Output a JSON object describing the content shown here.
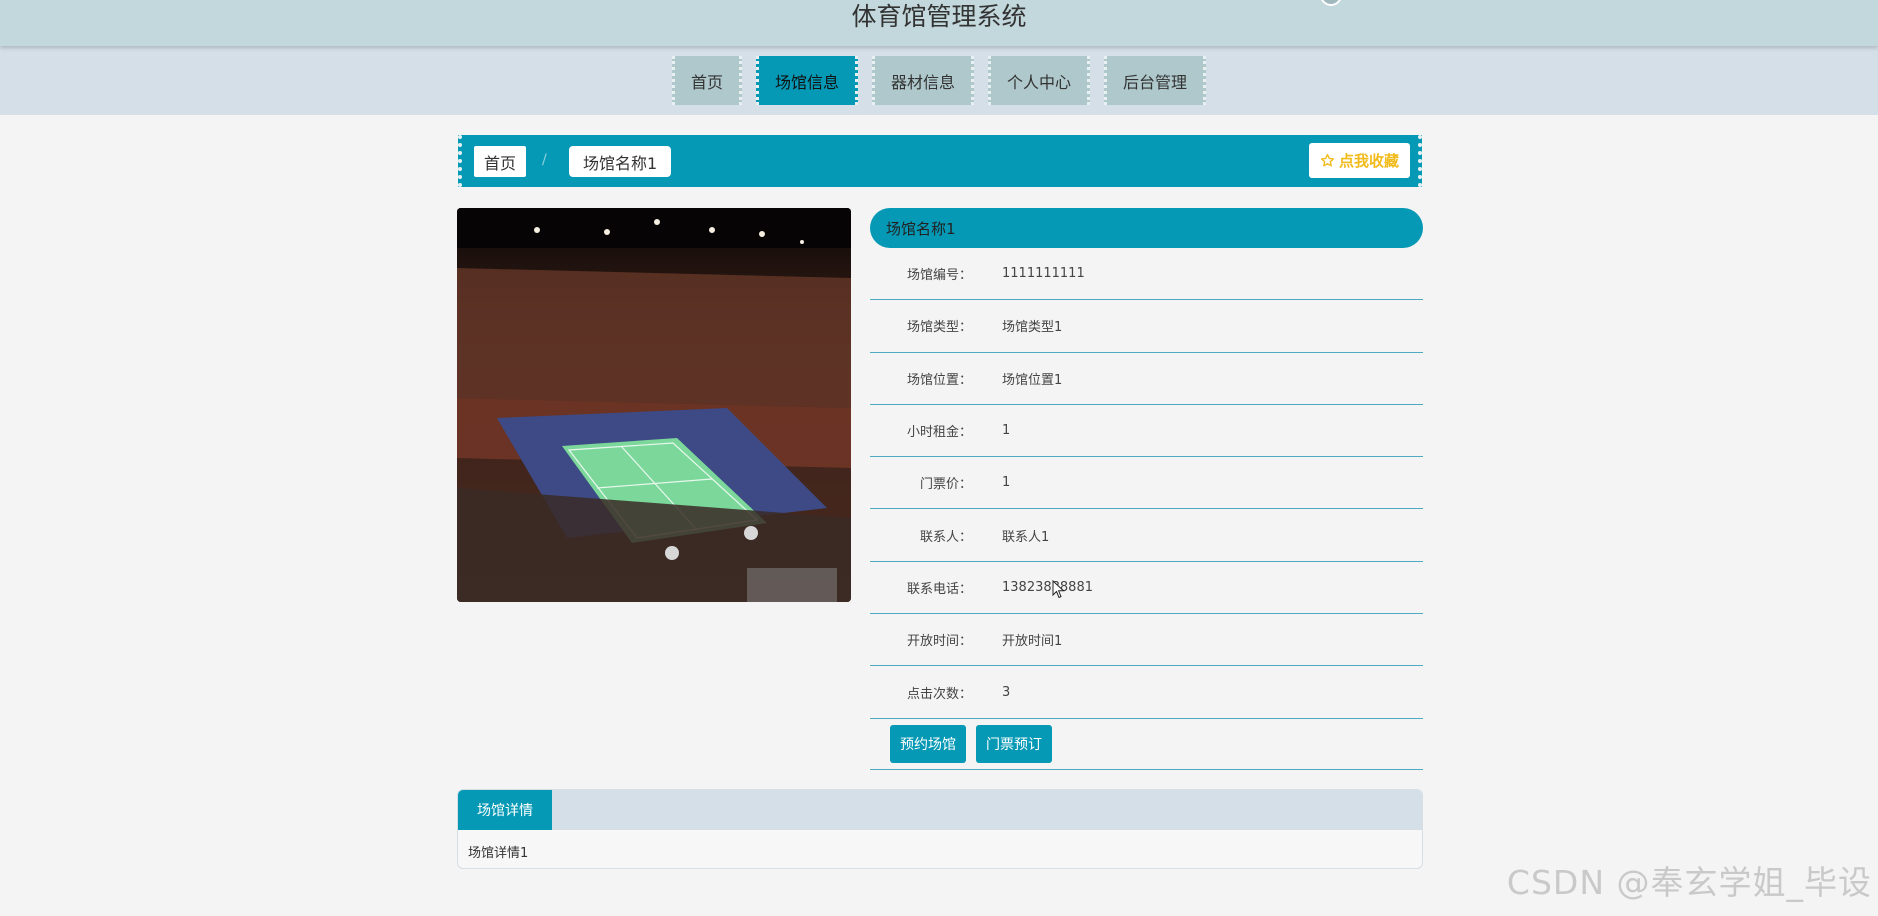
{
  "header": {
    "title": "体育馆管理系统"
  },
  "nav": {
    "items": [
      {
        "label": "首页",
        "active": false
      },
      {
        "label": "场馆信息",
        "active": true
      },
      {
        "label": "器材信息",
        "active": false
      },
      {
        "label": "个人中心",
        "active": false
      },
      {
        "label": "后台管理",
        "active": false
      }
    ]
  },
  "breadcrumb": {
    "home": "首页",
    "separator": "/",
    "current": "场馆名称1",
    "favorite": "点我收藏",
    "favorite_icon": "star-outline-icon"
  },
  "detail": {
    "name": "场馆名称1",
    "fields": [
      {
        "label": "场馆编号：",
        "value": "1111111111"
      },
      {
        "label": "场馆类型：",
        "value": "场馆类型1"
      },
      {
        "label": "场馆位置：",
        "value": "场馆位置1"
      },
      {
        "label": "小时租金：",
        "value": "1"
      },
      {
        "label": "门票价：",
        "value": "1"
      },
      {
        "label": "联系人：",
        "value": "联系人1"
      },
      {
        "label": "联系电话：",
        "value": "13823888881"
      },
      {
        "label": "开放时间：",
        "value": "开放时间1"
      },
      {
        "label": "点击次数：",
        "value": "3"
      }
    ],
    "actions": {
      "book_venue": "预约场馆",
      "book_ticket": "门票预订"
    }
  },
  "tabs": {
    "active_label": "场馆详情",
    "content": "场馆详情1"
  },
  "watermark": "CSDN @奉玄学姐_毕设",
  "colors": {
    "accent": "#0599b5",
    "header_bg": "#c2d8dc",
    "nav_bg": "#d4dfe7",
    "favorite": "#f2bb1c"
  }
}
